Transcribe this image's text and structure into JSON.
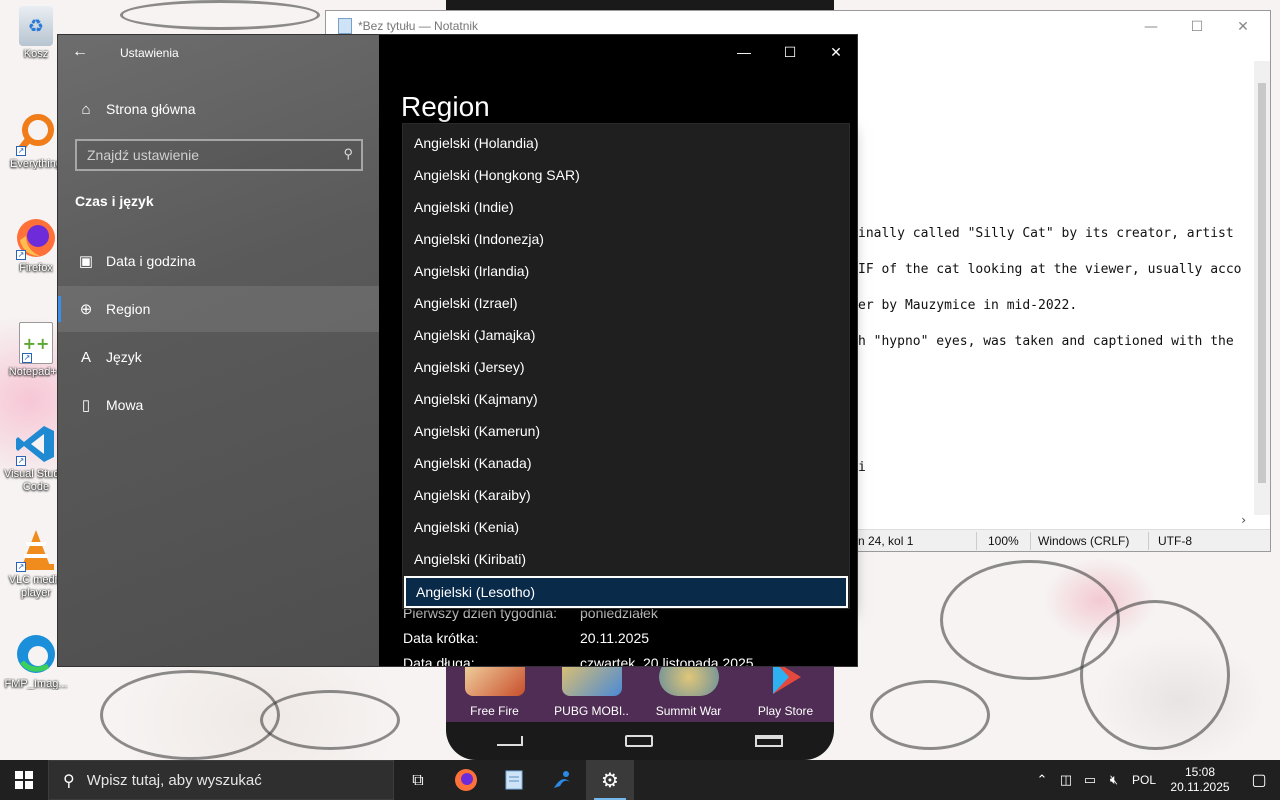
{
  "desktop": {
    "icons": [
      {
        "label": "Kosz",
        "icon": "recycle-bin-icon"
      },
      {
        "label": "Everything",
        "icon": "everything-search-icon"
      },
      {
        "label": "Firefox",
        "icon": "firefox-icon"
      },
      {
        "label": "Notepad++",
        "icon": "notepad-plus-plus-icon"
      },
      {
        "label": "Visual Studio Code",
        "icon": "vscode-icon"
      },
      {
        "label": "VLC media player",
        "icon": "vlc-icon"
      },
      {
        "label": "FMP_Imag...",
        "icon": "edge-icon"
      }
    ]
  },
  "phone": {
    "apps": [
      {
        "label": "Free Fire",
        "color": "#e8c58a"
      },
      {
        "label": "PUBG MOBI..",
        "color": "#d9b15a"
      },
      {
        "label": "Summit War",
        "color": "#b8a26a"
      },
      {
        "label": "Play Store",
        "color": "#4f2d55"
      }
    ]
  },
  "notepad": {
    "title": "*Bez tytułu — Notatnik",
    "lines": [
      "inally called \"Silly Cat\" by its creator, artist",
      "IF of the cat looking at the viewer, usually acco",
      "er by Mauzymice in mid-2022.",
      "h \"hypno\" eyes, was taken and captioned with the",
      "i"
    ],
    "status": {
      "position": "n 24, kol 1",
      "zoom": "100%",
      "line_ending": "Windows (CRLF)",
      "encoding": "UTF-8"
    }
  },
  "settings": {
    "app_title": "Ustawienia",
    "home_label": "Strona główna",
    "search_placeholder": "Znajdź ustawienie",
    "section_heading": "Czas i język",
    "nav": [
      {
        "label": "Data i godzina",
        "icon": "calendar-clock-icon"
      },
      {
        "label": "Region",
        "icon": "globe-icon"
      },
      {
        "label": "Język",
        "icon": "language-icon"
      },
      {
        "label": "Mowa",
        "icon": "microphone-icon"
      }
    ],
    "page_title": "Region",
    "format_rows": [
      {
        "label": "Pierwszy dzień tygodnia:",
        "value": "poniedziałek"
      },
      {
        "label": "Data krótka:",
        "value": "20.11.2025"
      },
      {
        "label": "Data długa:",
        "value": "czwartek, 20 listopada 2025"
      }
    ],
    "dropdown": {
      "items": [
        "Angielski (Holandia)",
        "Angielski (Hongkong SAR)",
        "Angielski (Indie)",
        "Angielski (Indonezja)",
        "Angielski (Irlandia)",
        "Angielski (Izrael)",
        "Angielski (Jamajka)",
        "Angielski (Jersey)",
        "Angielski (Kajmany)",
        "Angielski (Kamerun)",
        "Angielski (Kanada)",
        "Angielski (Karaiby)",
        "Angielski (Kenia)",
        "Angielski (Kiribati)",
        "Angielski (Lesotho)"
      ],
      "selected_index": 14
    },
    "accent_color": "#3b8eea"
  },
  "taskbar": {
    "search_placeholder": "Wpisz tutaj, aby wyszukać",
    "language": "POL",
    "time": "15:08",
    "date": "20.11.2025"
  }
}
